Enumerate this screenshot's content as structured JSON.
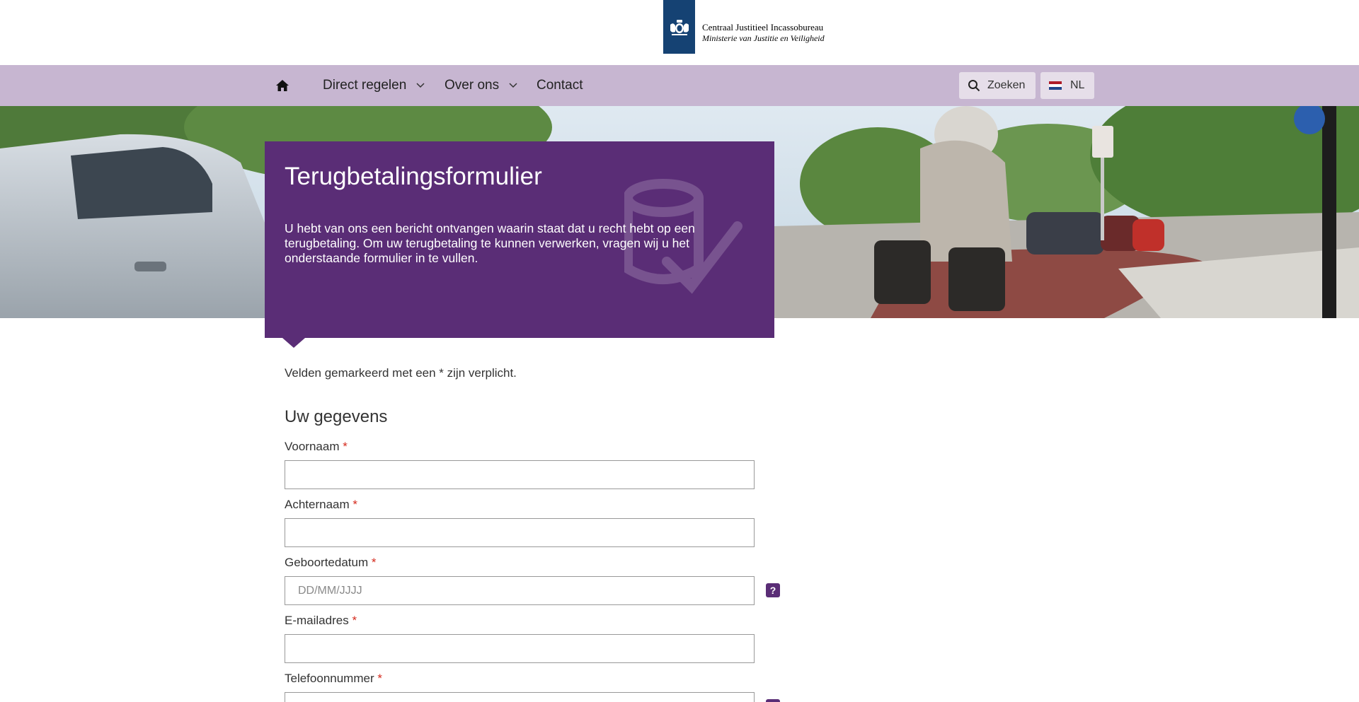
{
  "header": {
    "org_name": "Centraal Justitieel Incassobureau",
    "ministry": "Ministerie van Justitie en Veiligheid"
  },
  "nav": {
    "items": [
      {
        "label": "Direct regelen",
        "has_dropdown": true
      },
      {
        "label": "Over ons",
        "has_dropdown": true
      },
      {
        "label": "Contact",
        "has_dropdown": false
      }
    ],
    "search_label": "Zoeken",
    "language_label": "NL"
  },
  "hero": {
    "title": "Terugbetalingsformulier",
    "text": "U hebt van ons een bericht ontvangen waarin staat dat u recht hebt op een terugbetaling. Om uw terugbetaling te kunnen verwerken, vragen wij u het onderstaande formulier in te vullen."
  },
  "form": {
    "required_note": "Velden gemarkeerd met een * zijn verplicht.",
    "section_title": "Uw gegevens",
    "required_marker": "*",
    "help_label": "?",
    "fields": [
      {
        "label": "Voornaam",
        "value": "",
        "placeholder": ""
      },
      {
        "label": "Achternaam",
        "value": "",
        "placeholder": ""
      },
      {
        "label": "Geboortedatum",
        "value": "",
        "placeholder": "DD/MM/JJJJ"
      },
      {
        "label": "E-mailadres",
        "value": "",
        "placeholder": ""
      },
      {
        "label": "Telefoonnummer",
        "value": "",
        "placeholder": ""
      }
    ]
  },
  "colors": {
    "brand_purple": "#5a2d76",
    "nav_lilac": "#c7b6d1",
    "logo_blue": "#154273",
    "required_red": "#d52b1e"
  }
}
